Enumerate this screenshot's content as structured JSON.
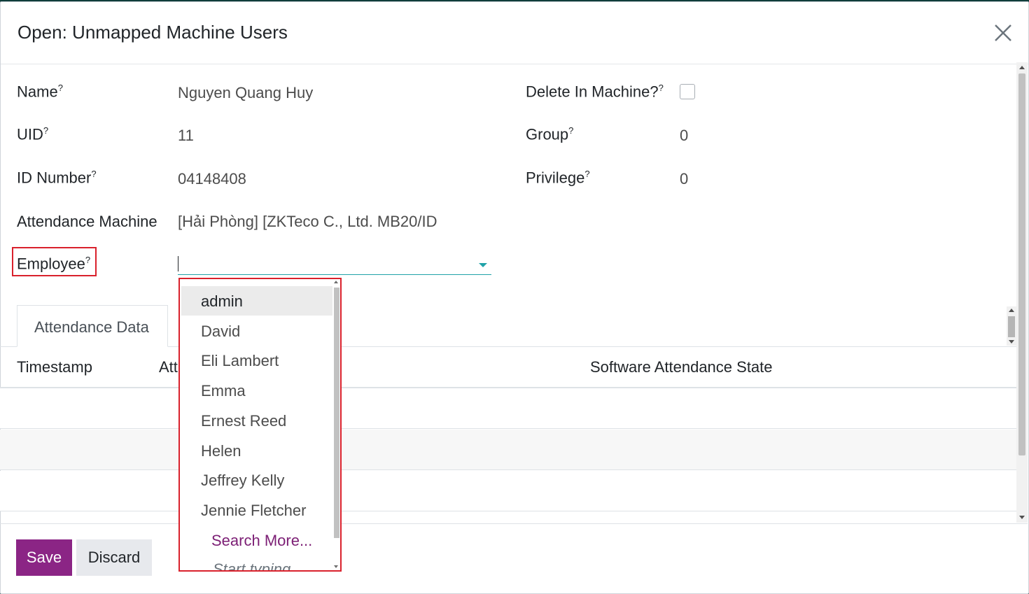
{
  "dialog": {
    "title": "Open: Unmapped Machine Users",
    "close_icon": "close-icon"
  },
  "form": {
    "name": {
      "label": "Name",
      "help": "?",
      "value": "Nguyen Quang Huy"
    },
    "uid": {
      "label": "UID",
      "help": "?",
      "value": "11"
    },
    "id_number": {
      "label": "ID Number",
      "help": "?",
      "value": "04148408"
    },
    "attendance_machine": {
      "label": "Attendance Machine",
      "value": "[Hải Phòng] [ZKTeco C., Ltd. MB20/ID"
    },
    "employee": {
      "label": "Employee",
      "help": "?",
      "value": ""
    },
    "delete_in_machine": {
      "label": "Delete In Machine?",
      "help": "?",
      "checked": false
    },
    "group": {
      "label": "Group",
      "help": "?",
      "value": "0"
    },
    "privilege": {
      "label": "Privilege",
      "help": "?",
      "value": "0"
    }
  },
  "tabs": [
    {
      "label": "Attendance Data",
      "active": true
    }
  ],
  "table": {
    "columns": [
      "Timestamp",
      "Att",
      "Software Attendance State"
    ],
    "rows": [
      [],
      [],
      []
    ]
  },
  "dropdown": {
    "items": [
      "admin",
      "David",
      "Eli Lambert",
      "Emma",
      "Ernest Reed",
      "Helen",
      "Jeffrey Kelly",
      "Jennie Fletcher"
    ],
    "highlighted": "admin",
    "search_more": "Search More...",
    "hint": "Start typing..."
  },
  "footer": {
    "save_label": "Save",
    "discard_label": "Discard"
  },
  "colors": {
    "primary": "#8b2585",
    "accent": "#20a2a8",
    "highlight_border": "#d9212c",
    "link": "#7c1f75"
  }
}
